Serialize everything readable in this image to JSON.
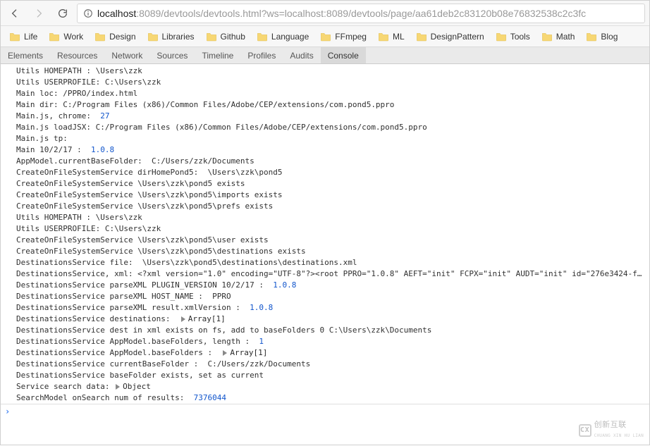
{
  "url": {
    "scheme_host": "localhost",
    "rest": ":8089/devtools/devtools.html?ws=localhost:8089/devtools/page/aa61deb2c83120b08e76832538c2c3fc"
  },
  "bookmarks": [
    "Life",
    "Work",
    "Design",
    "Libraries",
    "Github",
    "Language",
    "FFmpeg",
    "ML",
    "DesignPattern",
    "Tools",
    "Math",
    "Blog"
  ],
  "devtoolsTabs": [
    "Elements",
    "Resources",
    "Network",
    "Sources",
    "Timeline",
    "Profiles",
    "Audits",
    "Console"
  ],
  "activeTab": "Console",
  "logs": [
    {
      "t": "Utils HOMEPATH : \\Users\\zzk"
    },
    {
      "t": "Utils USERPROFILE: C:\\Users\\zzk"
    },
    {
      "t": "Main loc: /PPRO/index.html"
    },
    {
      "t": "Main dir: C:/Program Files (x86)/Common Files/Adobe/CEP/extensions/com.pond5.ppro"
    },
    {
      "t": "Main.js, chrome:  ",
      "n": "27"
    },
    {
      "t": "Main.js loadJSX: C:/Program Files (x86)/Common Files/Adobe/CEP/extensions/com.pond5.ppro"
    },
    {
      "t": "Main.js tp:"
    },
    {
      "t": "Main 10/2/17 :  ",
      "n": "1.0.8"
    },
    {
      "t": "AppModel.currentBaseFolder:  C:/Users/zzk/Documents"
    },
    {
      "t": "CreateOnFileSystemService dirHomePond5:  \\Users\\zzk\\pond5"
    },
    {
      "t": "CreateOnFileSystemService \\Users\\zzk\\pond5 exists"
    },
    {
      "t": "CreateOnFileSystemService \\Users\\zzk\\pond5\\imports exists"
    },
    {
      "t": "CreateOnFileSystemService \\Users\\zzk\\pond5\\prefs exists"
    },
    {
      "t": "Utils HOMEPATH : \\Users\\zzk"
    },
    {
      "t": "Utils USERPROFILE: C:\\Users\\zzk"
    },
    {
      "t": "CreateOnFileSystemService \\Users\\zzk\\pond5\\user exists"
    },
    {
      "t": "CreateOnFileSystemService \\Users\\zzk\\pond5\\destinations exists"
    },
    {
      "t": "DestinationsService file:  \\Users\\zzk\\pond5\\destinations\\destinations.xml"
    },
    {
      "t": "DestinationsService, xml: <?xml version=\"1.0\" encoding=\"UTF-8\"?><root PPRO=\"1.0.8\" AEFT=\"init\" FCPX=\"init\" AUDT=\"init\" id=\"276e3424-f…"
    },
    {
      "t": "DestinationsService parseXML PLUGIN_VERSION 10/2/17 :  ",
      "n": "1.0.8"
    },
    {
      "t": "DestinationsService parseXML HOST_NAME :  PPRO"
    },
    {
      "t": "DestinationsService parseXML result.xmlVersion :  ",
      "n": "1.0.8"
    },
    {
      "t": "DestinationsService destinations:  ",
      "arr": "Array[1]"
    },
    {
      "t": "DestinationsService dest in xml exists on fs, add to baseFolders 0 C:\\Users\\zzk\\Documents"
    },
    {
      "t": "DestinationsService AppModel.baseFolders, length :  ",
      "n": "1"
    },
    {
      "t": "DestinationsService AppModel.baseFolders :  ",
      "arr": "Array[1]"
    },
    {
      "t": "DestinationsService currentBaseFolder :  C:/Users/zzk/Documents"
    },
    {
      "t": "DestinationsService baseFolder exists, set as current"
    },
    {
      "t": "Service search data: ",
      "arr": "Object"
    },
    {
      "t": "SearchModel onSearch num of results:  ",
      "n": "7376044"
    }
  ],
  "watermark": {
    "brand": "创新互联",
    "sub": "CHUANG XIN HU LIAN",
    "logo": "CX"
  }
}
